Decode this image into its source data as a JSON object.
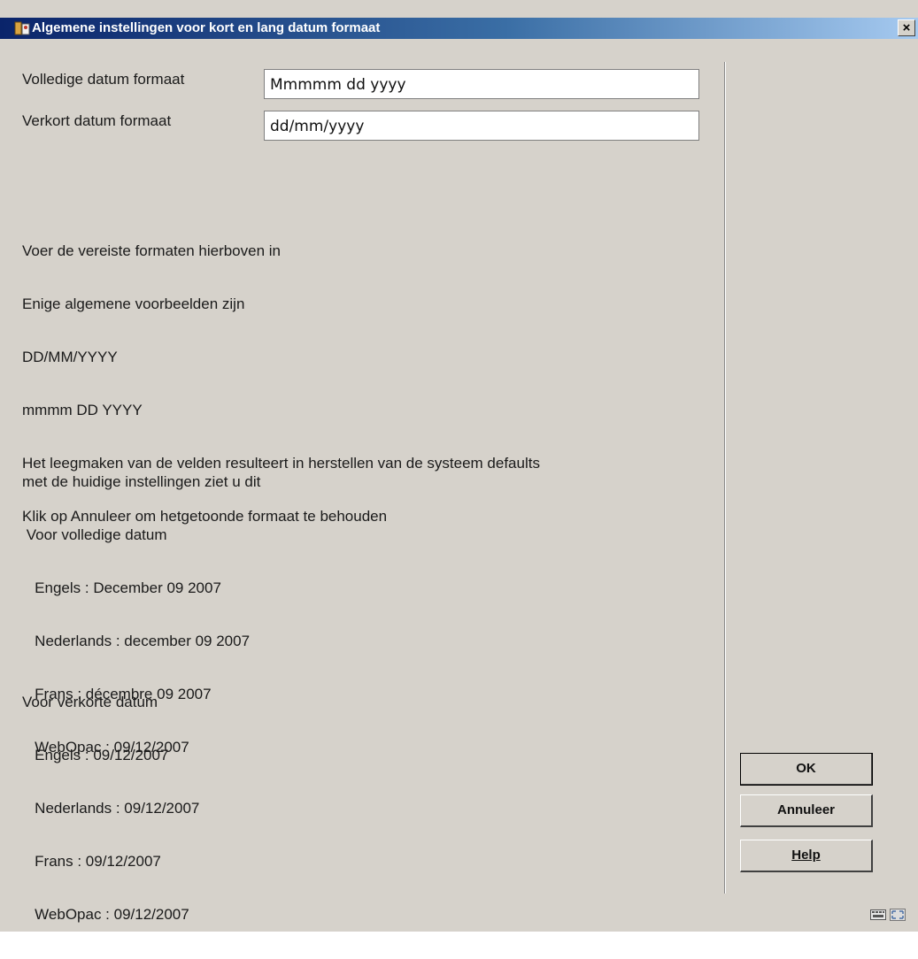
{
  "window": {
    "title": "Algemene instellingen voor kort en lang datum formaat",
    "close_glyph": "×"
  },
  "form": {
    "long_label": "Volledige datum formaat",
    "long_value": "Mmmmm dd yyyy",
    "short_label": "Verkort datum formaat",
    "short_value": "dd/mm/yyyy"
  },
  "instructions": [
    "Voer de vereiste formaten hierboven in",
    "Enige algemene voorbeelden zijn",
    "DD/MM/YYYY",
    "mmmm DD YYYY",
    "Het leegmaken van de velden resulteert in herstellen van de systeem defaults",
    "Klik op Annuleer om hetgetoonde formaat te behouden"
  ],
  "long_preview": [
    "met de huidige instellingen ziet u dit",
    " Voor volledige datum",
    "   Engels : December 09 2007",
    "   Nederlands : december 09 2007",
    "   Frans : décembre 09 2007",
    "   WebOpac : 09/12/2007"
  ],
  "short_preview": [
    "Voor verkorte datum",
    "   Engels : 09/12/2007",
    "   Nederlands : 09/12/2007",
    "   Frans : 09/12/2007",
    "   WebOpac : 09/12/2007"
  ],
  "buttons": {
    "ok": "OK",
    "cancel": "Annuleer",
    "help": "Help"
  },
  "colors": {
    "title_gradient_start": "#0a246a",
    "title_gradient_end": "#a6caf0",
    "dialog_bg": "#d6d2cb"
  }
}
